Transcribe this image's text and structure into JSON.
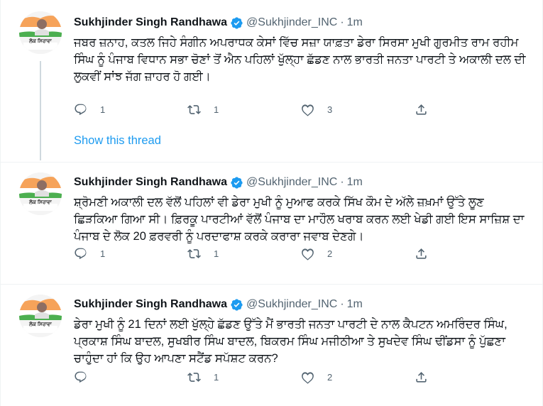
{
  "tweets": [
    {
      "name": "Sukhjinder Singh Randhawa",
      "handle": "@Sukhjinder_INC",
      "separator": "·",
      "time": "1m",
      "avatar_caption": "ਲੋਕ ਸਿਰਾਵਾ",
      "text": "ਜਬਰ ਜ਼ਨਾਹ, ਕਤਲ ਜਿਹੇ ਸੰਗੀਨ ਅਪਰਾਧਕ ਕੇਸਾਂ ਵਿੱਚ ਸਜ਼ਾ ਯਾਫ਼ਤਾ ਡੇਰਾ ਸਿਰਸਾ ਮੁਖੀ ਗੁਰਮੀਤ ਰਾਮ ਰਹੀਮ ਸਿੰਘ ਨੂੰ ਪੰਜਾਬ ਵਿਧਾਨ ਸਭਾ ਚੋਣਾਂ ਤੋਂ ਐਨ ਪਹਿਲਾਂ ਖੁੱਲ੍ਹਾ ਛੱਡਣ ਨਾਲ ਭਾਰਤੀ ਜਨਤਾ ਪਾਰਟੀ ਤੇ ਅਕਾਲੀ ਦਲ ਦੀ ਲੁਕਵੀਂ ਸਾਂਝ ਜੱਗ ਜ਼ਾਹਰ ਹੋ ਗਈ।",
      "replies": "1",
      "retweets": "1",
      "likes": "3",
      "show_thread": "Show this thread"
    },
    {
      "name": "Sukhjinder Singh Randhawa",
      "handle": "@Sukhjinder_INC",
      "separator": "·",
      "time": "1m",
      "avatar_caption": "ਲੋਕ ਸਿਰਾਵਾ",
      "text": "ਸ਼੍ਰੋਮਣੀ ਅਕਾਲੀ ਦਲ ਵੱਲੋਂ ਪਹਿਲਾਂ ਵੀ ਡੇਰਾ ਮੁਖੀ ਨੂੰ ਮੁਆਫ ਕਰਕੇ ਸਿੱਖ ਕੌਮ ਦੇ ਅੱਲੇ ਜ਼ਖ਼ਮਾਂ ਉੱਤੇ ਲੂਣ ਛਿੜਕਿਆ ਗਿਆ ਸੀ। ਫ਼ਿਰਕੂ ਪਾਰਟੀਆਂ ਵੱਲੋਂ ਪੰਜਾਬ ਦਾ ਮਾਹੌਲ ਖਰਾਬ ਕਰਨ ਲਈ ਖੇਡੀ ਗਈ ਇਸ ਸਾਜ਼ਿਸ਼ ਦਾ ਪੰਜਾਬ ਦੇ ਲੋਕ 20 ਫ਼ਰਵਰੀ ਨੂੰ ਪਰਦਾਫਾਸ਼ ਕਰਕੇ ਕਰਾਰਾ ਜਵਾਬ ਦੇਣਗੇ।",
      "replies": "1",
      "retweets": "1",
      "likes": "2"
    },
    {
      "name": "Sukhjinder Singh Randhawa",
      "handle": "@Sukhjinder_INC",
      "separator": "·",
      "time": "1m",
      "avatar_caption": "ਲੋਕ ਸਿਰਾਵਾ",
      "text": "ਡੇਰਾ ਮੁਖੀ ਨੂੰ 21 ਦਿਨਾਂ ਲਈ ਖੁੱਲ੍ਹੇ ਛੱਡਣ ਉੱਤੇ ਮੈਂ ਭਾਰਤੀ ਜਨਤਾ ਪਾਰਟੀ ਦੇ ਨਾਲ ਕੈਪਟਨ ਅਮਰਿੰਦਰ ਸਿੰਘ, ਪ੍ਰਕਾਸ਼ ਸਿੰਘ ਬਾਦਲ, ਸੁਖਬੀਰ ਸਿੰਘ ਬਾਦਲ, ਬਿਕਰਮ ਸਿੰਘ ਮਜੀਠੀਆ ਤੇ ਸੁਖਦੇਵ ਸਿੰਘ ਢੀਂਡਸਾ ਨੂੰ ਪੁੱਛਣਾ ਚਾਹੁੰਦਾ ਹਾਂ ਕਿ ਉਹ ਆਪਣਾ ਸਟੈਂਡ ਸਪੱਸ਼ਟ ਕਰਨ?",
      "replies": "",
      "retweets": "1",
      "likes": "2"
    }
  ],
  "colors": {
    "link": "#1d9bf0",
    "muted": "#536471",
    "verified": "#1d9bf0"
  },
  "icons": [
    "reply-icon",
    "retweet-icon",
    "like-icon",
    "share-icon",
    "verified-badge-icon"
  ]
}
